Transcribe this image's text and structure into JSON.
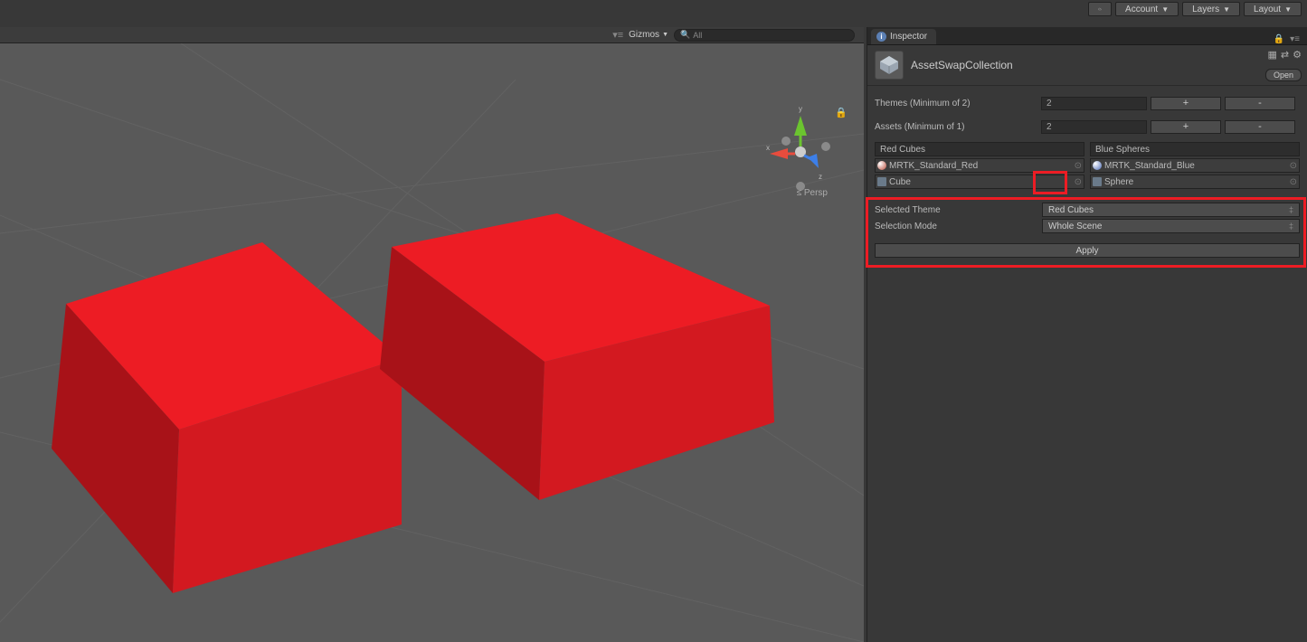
{
  "toolbar": {
    "account_label": "Account",
    "layers_label": "Layers",
    "layout_label": "Layout"
  },
  "scene": {
    "gizmos_label": "Gizmos",
    "search_placeholder": "All",
    "persp_label": "Persp",
    "axis_x": "x",
    "axis_y": "y",
    "axis_z": "z"
  },
  "inspector": {
    "tab_label": "Inspector",
    "object_name": "AssetSwapCollection",
    "open_label": "Open",
    "themes_label": "Themes (Minimum of 2)",
    "themes_value": "2",
    "assets_label": "Assets (Minimum of 1)",
    "assets_value": "2",
    "plus": "+",
    "minus": "-",
    "columns": [
      {
        "header": "Red Cubes",
        "rows": [
          {
            "icon_color": "#b84c3c",
            "label": "MRTK_Standard_Red"
          },
          {
            "icon_type": "prefab",
            "label": "Cube"
          }
        ]
      },
      {
        "header": "Blue Spheres",
        "rows": [
          {
            "icon_color": "#4c6cb8",
            "label": "MRTK_Standard_Blue"
          },
          {
            "icon_type": "prefab",
            "label": "Sphere"
          }
        ]
      }
    ],
    "selected_theme_label": "Selected Theme",
    "selected_theme_value": "Red Cubes",
    "selection_mode_label": "Selection Mode",
    "selection_mode_value": "Whole Scene",
    "apply_label": "Apply"
  }
}
